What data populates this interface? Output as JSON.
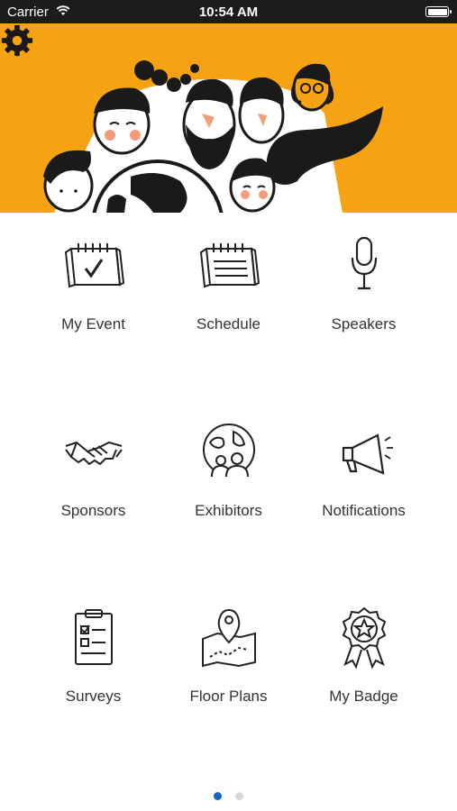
{
  "status_bar": {
    "carrier": "Carrier",
    "time": "10:54 AM"
  },
  "header": {
    "settings_icon": "gear-icon",
    "accent_color": "#f6a313"
  },
  "menu": [
    {
      "label": "My Event",
      "icon": "calendar-check-icon"
    },
    {
      "label": "Schedule",
      "icon": "calendar-icon"
    },
    {
      "label": "Speakers",
      "icon": "microphone-icon"
    },
    {
      "label": "Sponsors",
      "icon": "handshake-icon"
    },
    {
      "label": "Exhibitors",
      "icon": "globe-people-icon"
    },
    {
      "label": "Notifications",
      "icon": "megaphone-icon"
    },
    {
      "label": "Surveys",
      "icon": "clipboard-checklist-icon"
    },
    {
      "label": "Floor Plans",
      "icon": "map-pin-icon"
    },
    {
      "label": "My Badge",
      "icon": "badge-ribbon-icon"
    }
  ],
  "pagination": {
    "current": 1,
    "total": 2,
    "active_color": "#1463c7"
  }
}
